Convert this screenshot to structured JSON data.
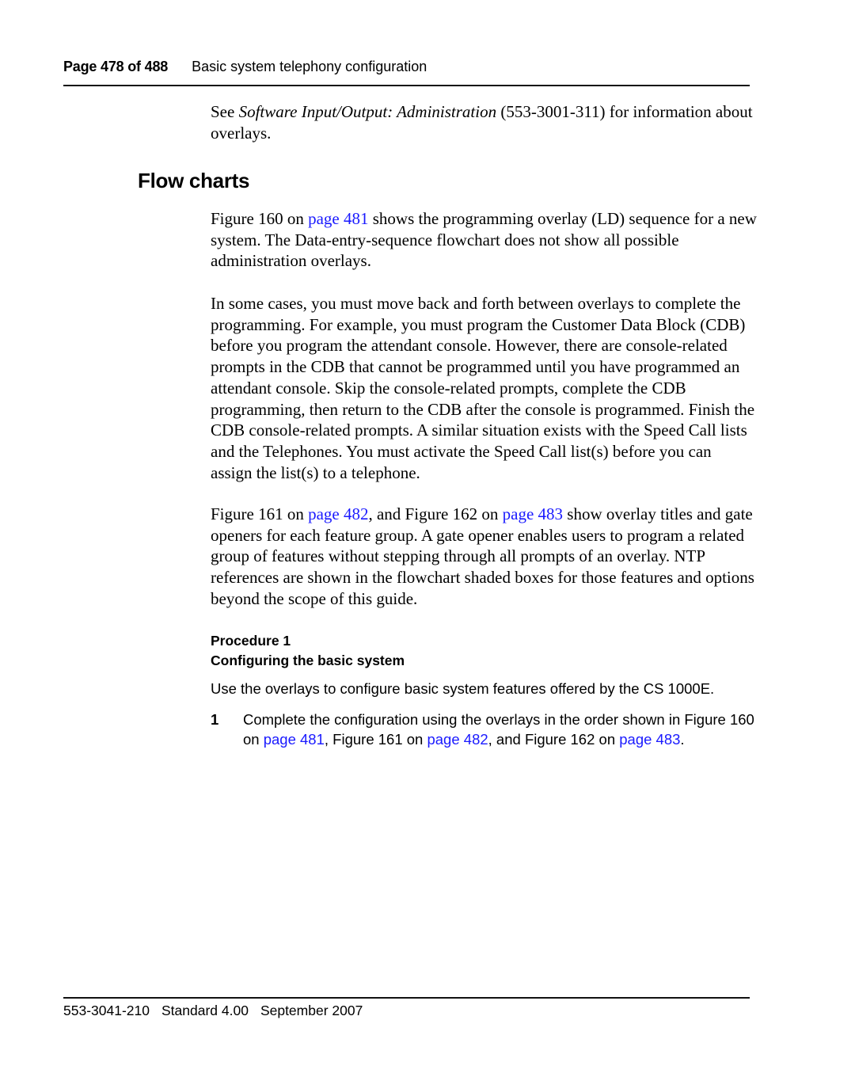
{
  "header": {
    "page_label": "Page 478 of 488",
    "section_title": "Basic system telephony configuration"
  },
  "intro": {
    "pre": "See ",
    "doc_title": "Software Input/Output: Administration",
    "post": " (553-3001-311) for information about overlays."
  },
  "section": {
    "title": "Flow charts"
  },
  "paragraphs": {
    "p1": {
      "pre": "Figure 160 on ",
      "link": "page 481",
      "post": " shows the programming overlay (LD) sequence for a new system. The Data-entry-sequence flowchart does not show all possible administration overlays."
    },
    "p2": "In some cases, you must move back and forth between overlays to complete the programming. For example, you must program the Customer Data Block (CDB) before you program the attendant console. However, there are console-related prompts in the CDB that cannot be programmed until you have programmed an attendant console. Skip the console-related prompts, complete the CDB programming, then return to the CDB after the console is programmed. Finish the CDB console-related prompts. A similar situation exists with the Speed Call lists and the Telephones. You must activate the Speed Call list(s) before you can assign the list(s) to a telephone.",
    "p3": {
      "t1": "Figure 161 on ",
      "link1": "page 482",
      "t2": ", and Figure 162 on ",
      "link2": "page 483",
      "t3": " show overlay titles and gate openers for each feature group. A gate opener enables users to program a related group of features without stepping through all prompts of an overlay. NTP references are shown in the flowchart shaded boxes for those features and options beyond the scope of this guide."
    }
  },
  "procedure": {
    "label": "Procedure 1",
    "title": "Configuring the basic system",
    "intro": "Use the overlays to configure basic system features offered by the CS 1000E.",
    "steps": [
      {
        "number": "1",
        "t1": "Complete the configuration using the overlays in the order shown in Figure 160 on ",
        "link1": "page 481",
        "t2": ", Figure 161 on ",
        "link2": "page 482",
        "t3": ", and Figure 162 on ",
        "link3": "page 483",
        "t4": "."
      }
    ]
  },
  "footer": {
    "doc_number": "553-3041-210",
    "standard": "Standard 4.00",
    "date": "September 2007"
  },
  "colors": {
    "link": "#1a1aff",
    "text": "#000000",
    "rule": "#111111"
  }
}
